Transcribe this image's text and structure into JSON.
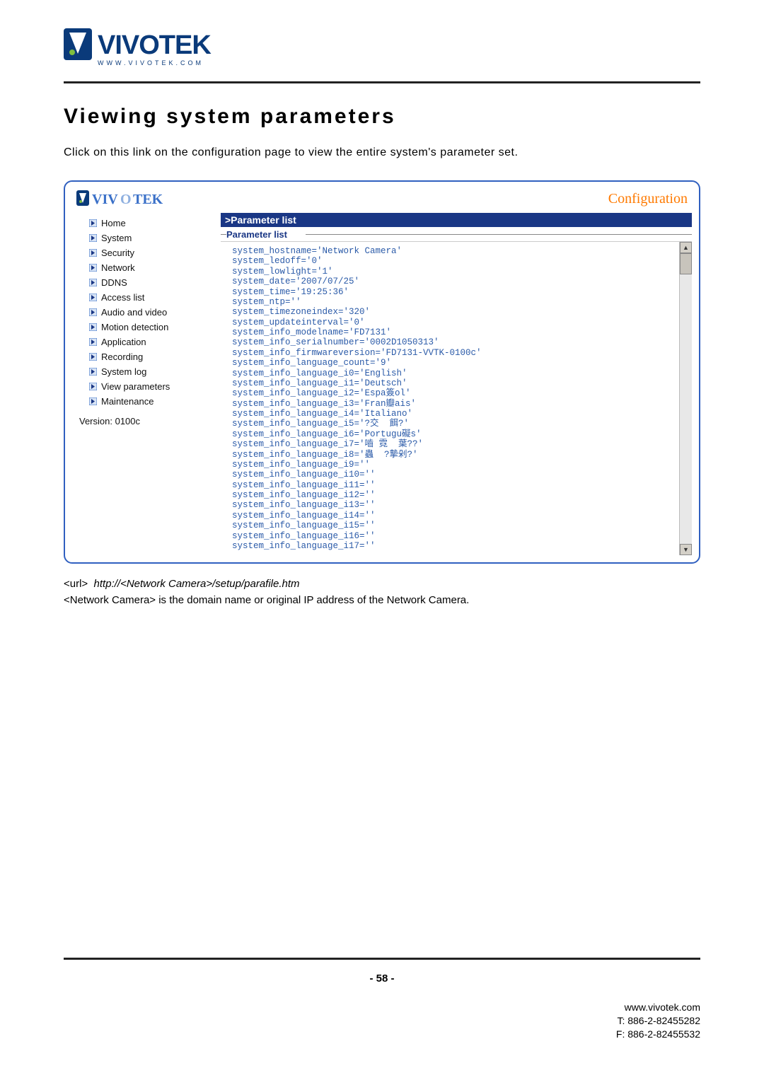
{
  "page": {
    "logo_subtext": "www.vivotek.com",
    "title": "Viewing system parameters",
    "intro": "Click on this link on the configuration page to view the entire system's parameter set.",
    "url_prefix": "<url>",
    "url_value": "http://<Network Camera>/setup/parafile.htm",
    "note": "<Network Camera> is the domain name or original IP address of the Network Camera.",
    "page_number": "- 58 -"
  },
  "footer": {
    "site": "www.vivotek.com",
    "tel": "T: 886-2-82455282",
    "fax": "F: 886-2-82455532"
  },
  "configbox": {
    "configuration_label": "Configuration",
    "parameter_list_header": ">Parameter list",
    "parameter_list_sub": "Parameter list"
  },
  "sidebar": {
    "items": [
      {
        "label": "Home"
      },
      {
        "label": "System"
      },
      {
        "label": "Security"
      },
      {
        "label": "Network"
      },
      {
        "label": "DDNS"
      },
      {
        "label": "Access list"
      },
      {
        "label": "Audio and video"
      },
      {
        "label": "Motion detection"
      },
      {
        "label": "Application"
      },
      {
        "label": "Recording"
      },
      {
        "label": "System log"
      },
      {
        "label": "View parameters"
      },
      {
        "label": "Maintenance"
      }
    ],
    "version": "Version: 0100c"
  },
  "parameters": {
    "lines": [
      "system_hostname='Network Camera'",
      "system_ledoff='0'",
      "system_lowlight='1'",
      "system_date='2007/07/25'",
      "system_time='19:25:36'",
      "system_ntp=''",
      "system_timezoneindex='320'",
      "system_updateinterval='0'",
      "system_info_modelname='FD7131'",
      "system_info_serialnumber='0002D1050313'",
      "system_info_firmwareversion='FD7131-VVTK-0100c'",
      "system_info_language_count='9'",
      "system_info_language_i0='English'",
      "system_info_language_i1='Deutsch'",
      "system_info_language_i2='Espa簽ol'",
      "system_info_language_i3='Fran瓣ais'",
      "system_info_language_i4='Italiano'",
      "system_info_language_i5='?交  餌?'",
      "system_info_language_i6='Portugu礙s'",
      "system_info_language_i7='嚙 霓  葉??'",
      "system_info_language_i8='蟲  ?摯剁?'",
      "system_info_language_i9=''",
      "system_info_language_i10=''",
      "system_info_language_i11=''",
      "system_info_language_i12=''",
      "system_info_language_i13=''",
      "system_info_language_i14=''",
      "system_info_language_i15=''",
      "system_info_language_i16=''",
      "system_info_language_i17=''"
    ]
  }
}
